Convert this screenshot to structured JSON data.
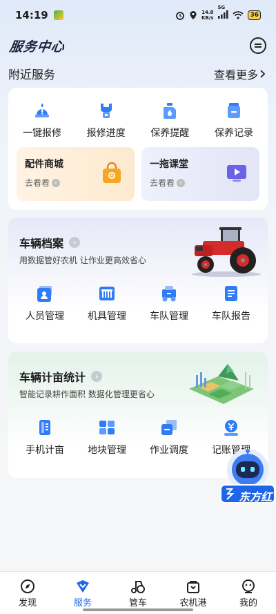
{
  "status_bar": {
    "time": "14:19",
    "speed": "14.8",
    "speed_unit": "KB/s",
    "network": "5G",
    "battery": "36"
  },
  "header": {
    "title": "服务中心"
  },
  "nearby": {
    "title": "附近服务",
    "more": "查看更多"
  },
  "quick_services": [
    {
      "label": "一键报修",
      "icon": "alert-icon"
    },
    {
      "label": "报修进度",
      "icon": "wrench-icon"
    },
    {
      "label": "保养提醒",
      "icon": "oil-can-icon"
    },
    {
      "label": "保养记录",
      "icon": "record-icon"
    }
  ],
  "promos": [
    {
      "title": "配件商城",
      "sub": "去看看",
      "icon": "shopping-bag-icon"
    },
    {
      "title": "一拖课堂",
      "sub": "去看看",
      "icon": "video-play-icon"
    }
  ],
  "vehicle_archive": {
    "title": "车辆档案",
    "subtitle": "用数据管好农机 让作业更高效省心",
    "items": [
      {
        "label": "人员管理",
        "icon": "person-card-icon"
      },
      {
        "label": "机具管理",
        "icon": "implement-icon"
      },
      {
        "label": "车队管理",
        "icon": "fleet-icon"
      },
      {
        "label": "车队报告",
        "icon": "report-icon"
      }
    ]
  },
  "area_stats": {
    "title": "车辆计亩统计",
    "subtitle": "智能记录耕作面积 数据化管理更省心",
    "items": [
      {
        "label": "手机计亩",
        "icon": "phone-measure-icon"
      },
      {
        "label": "地块管理",
        "icon": "plot-icon"
      },
      {
        "label": "作业调度",
        "icon": "dispatch-icon"
      },
      {
        "label": "记账管理",
        "icon": "accounting-icon"
      }
    ]
  },
  "assistant": {
    "brand": "东方红"
  },
  "tabs": [
    {
      "label": "发现",
      "icon": "compass-icon",
      "active": false
    },
    {
      "label": "服务",
      "icon": "service-icon",
      "active": true
    },
    {
      "label": "管车",
      "icon": "tractor-icon",
      "active": false
    },
    {
      "label": "农机港",
      "icon": "bag-icon",
      "active": false
    },
    {
      "label": "我的",
      "icon": "profile-icon",
      "active": false
    }
  ],
  "colors": {
    "accent": "#1e66e8",
    "icon_blue": "#2f7cf6",
    "promo_orange": "#f5a623",
    "promo_purple": "#6a63e8"
  }
}
